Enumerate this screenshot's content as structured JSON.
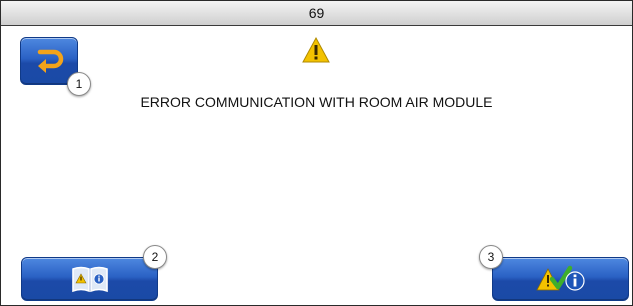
{
  "title_bar": {
    "text": "69"
  },
  "message": {
    "text": "ERROR COMMUNICATION WITH ROOM AIR MODULE"
  },
  "buttons": {
    "back": {
      "badge": "1",
      "icon": "return-arrow-icon"
    },
    "help": {
      "badge": "2",
      "icon": "manual-book-icon"
    },
    "acknowledge": {
      "badge": "3",
      "icon": "acknowledge-warning-info-icon"
    }
  },
  "warning_icon": {
    "icon": "warning-triangle-icon"
  },
  "colors": {
    "button_blue": "#2a61c4",
    "warning_yellow": "#f3c200",
    "check_green": "#3fae2b"
  }
}
